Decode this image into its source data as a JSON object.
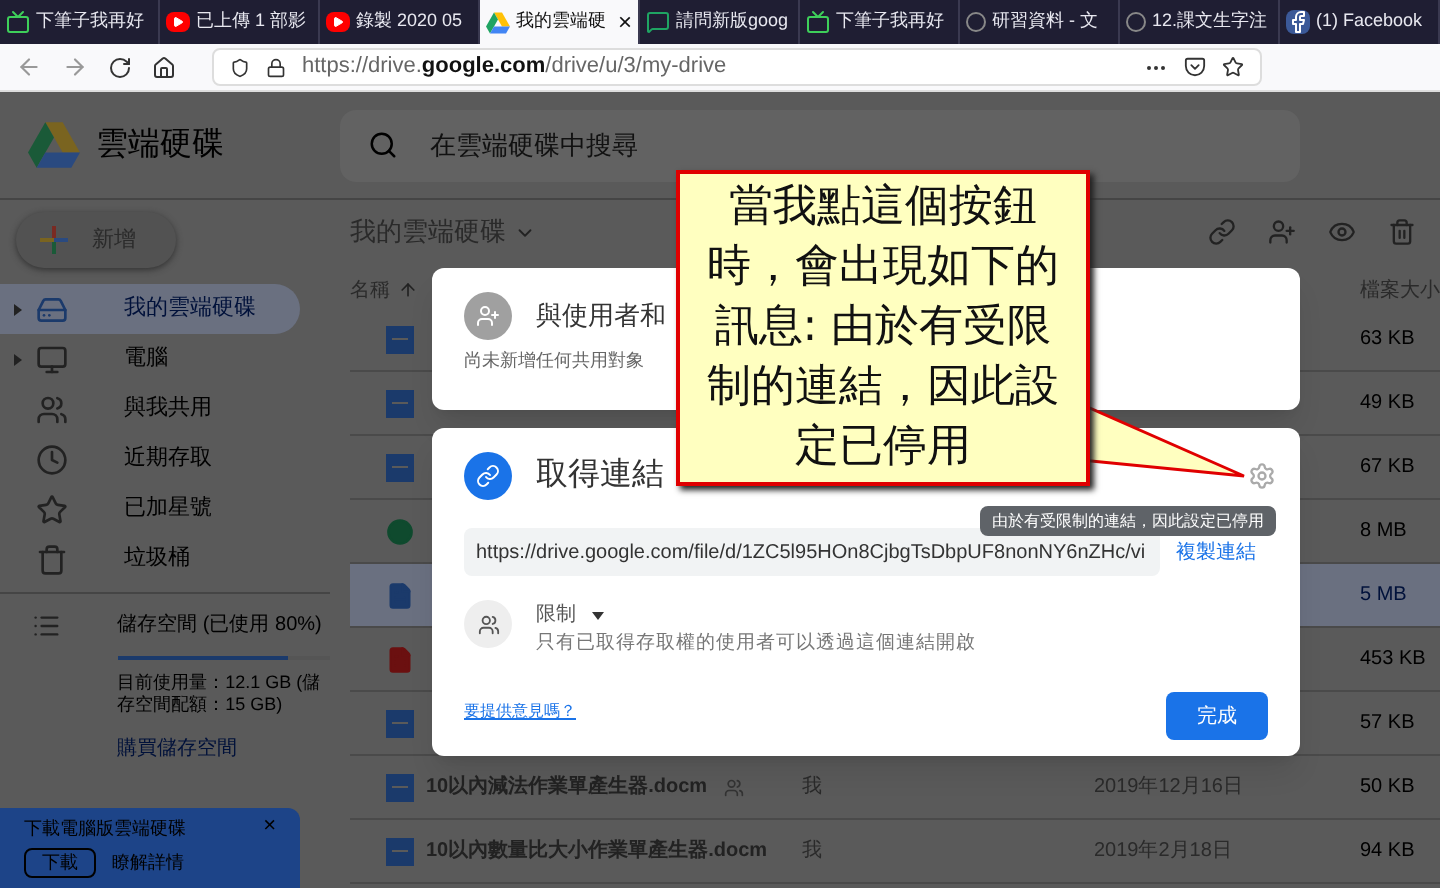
{
  "browser": {
    "tabs": [
      {
        "kind": "bili",
        "label": "下筆子我再好",
        "selected": false
      },
      {
        "kind": "youtube",
        "label": "已上傳 1 部影",
        "selected": false
      },
      {
        "kind": "youtube",
        "label": "錄製 2020 05",
        "selected": false
      },
      {
        "kind": "drive",
        "label": "我的雲端硬",
        "selected": true,
        "close": "×"
      },
      {
        "kind": "classroom",
        "label": "請問新版goog",
        "selected": false
      },
      {
        "kind": "bili",
        "label": "下筆子我再好",
        "selected": false
      },
      {
        "kind": "w",
        "label": "研習資料 - 文",
        "selected": false
      },
      {
        "kind": "w",
        "label": "12.課文生字注",
        "selected": false
      },
      {
        "kind": "facebook",
        "label": "(1) Facebook",
        "selected": false
      }
    ],
    "url": "https://drive.**google.com**/drive/u/3/my-drive"
  },
  "header": {
    "title": "雲端硬碟",
    "search_placeholder": "在雲端硬碟中搜尋"
  },
  "sidebar": {
    "new_button": "新增",
    "items": [
      {
        "kind": "drive",
        "label": "我的雲端硬碟",
        "selected": true,
        "expandable": true
      },
      {
        "kind": "computer",
        "label": "電腦",
        "selected": false,
        "expandable": true
      },
      {
        "kind": "shared",
        "label": "與我共用",
        "selected": false,
        "expandable": false
      },
      {
        "kind": "recent",
        "label": "近期存取",
        "selected": false,
        "expandable": false
      },
      {
        "kind": "star",
        "label": "已加星號",
        "selected": false,
        "expandable": false
      },
      {
        "kind": "trash",
        "label": "垃圾桶",
        "selected": false,
        "expandable": false
      }
    ],
    "storage": {
      "label": "儲存空間 (已使用 80%)",
      "level": 0.8,
      "usage": "目前使用量：12.1 GB (儲存空間配額：15 GB)",
      "buy": "購買儲存空間"
    },
    "promo": {
      "title": "下載電腦版雲端硬碟",
      "close": "×",
      "download": "下載",
      "learn_more": "瞭解詳情"
    }
  },
  "main": {
    "title": "我的雲端硬碟",
    "columns": [
      "名稱",
      "檔案大小"
    ],
    "rows": [
      {
        "kind": "word",
        "size": "63 KB",
        "selected": false
      },
      {
        "kind": "word",
        "size": "49 KB",
        "selected": false
      },
      {
        "kind": "word",
        "size": "67 KB",
        "selected": false
      },
      {
        "kind": "sheet",
        "size": "8 MB",
        "selected": false
      },
      {
        "kind": "doc",
        "size": "5 MB",
        "selected": true
      },
      {
        "kind": "pdf",
        "size": "453 KB",
        "selected": false
      },
      {
        "kind": "word",
        "size": "57 KB",
        "selected": false
      },
      {
        "kind": "word",
        "name": "10以內減法作業單產生器.docm",
        "shared": true,
        "owner": "我",
        "date": "2019年12月16日",
        "size": "50 KB",
        "selected": false
      },
      {
        "kind": "word",
        "name": "10以內數量比大小作業單產生器.docm",
        "shared": false,
        "owner": "我",
        "date": "2019年2月18日",
        "size": "94 KB",
        "selected": false
      }
    ]
  },
  "share_dialog": {
    "title": "與使用者和",
    "subtitle": "尚未新增任何共用對象"
  },
  "link_dialog": {
    "title": "取得連結",
    "url": "https://drive.google.com/file/d/1ZC5l95HOn8CjbgTsDbpUF8nonNY6nZHc/vi",
    "copy": "複製連結",
    "tooltip": "由於有受限制的連結，因此設定已停用",
    "access": "限制",
    "access_note": "只有已取得存取權的使用者可以透過這個連結開啟",
    "feedback": "要提供意見嗎？",
    "done": "完成"
  },
  "callout": {
    "text": "當我點這個按鈕時，會出現如下的訊息: 由於有受限制的連結，因此設定已停用"
  }
}
